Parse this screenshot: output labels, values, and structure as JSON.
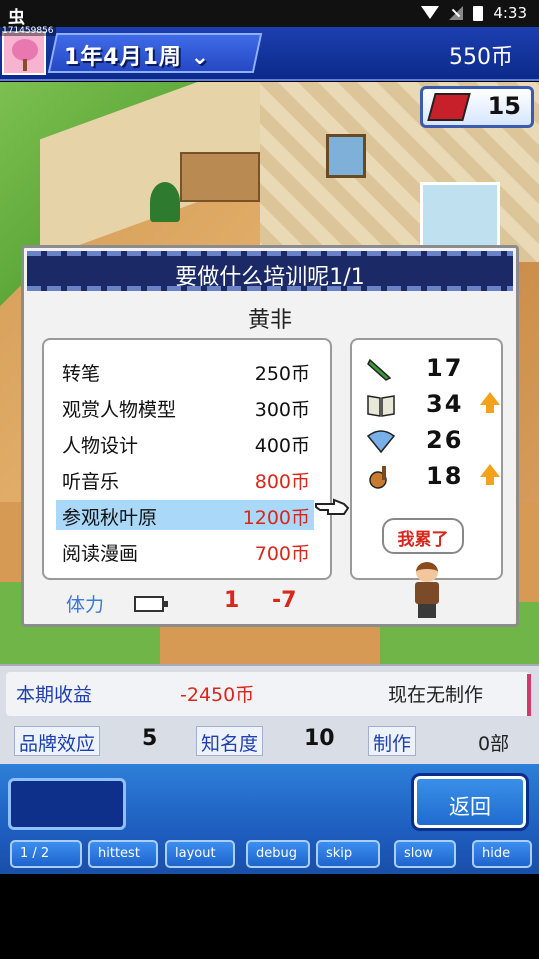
{
  "status_bar": {
    "time": "4:33",
    "left_icon": "虫",
    "icons": [
      "wifi-icon",
      "signal-icon",
      "battery-icon"
    ]
  },
  "header": {
    "user_id": "171459856",
    "date": "1年4月1周",
    "date_dropdown": "⌄",
    "money": "550币"
  },
  "tickets": {
    "count": "15"
  },
  "dialog": {
    "title": "要做什么培训呢1/1",
    "character_name": "黄非",
    "options": [
      {
        "name": "转笔",
        "cost": "250币",
        "affordable": true,
        "selected": false
      },
      {
        "name": "观赏人物模型",
        "cost": "300币",
        "affordable": true,
        "selected": false
      },
      {
        "name": "人物设计",
        "cost": "400币",
        "affordable": true,
        "selected": false
      },
      {
        "name": "听音乐",
        "cost": "800币",
        "affordable": false,
        "selected": false
      },
      {
        "name": "参观秋叶原",
        "cost": "1200币",
        "affordable": false,
        "selected": true
      },
      {
        "name": "阅读漫画",
        "cost": "700币",
        "affordable": false,
        "selected": false
      }
    ],
    "stats": [
      {
        "icon": "pencil-icon",
        "value": "17",
        "up": false
      },
      {
        "icon": "book-icon",
        "value": "34",
        "up": true
      },
      {
        "icon": "fan-icon",
        "value": "26",
        "up": false
      },
      {
        "icon": "guitar-icon",
        "value": "18",
        "up": true
      }
    ],
    "speech_bubble": "我累了",
    "stamina": {
      "label": "体力",
      "value": "1",
      "delta": "-7"
    }
  },
  "info_panel": {
    "income_label": "本期收益",
    "income_value": "-2450币",
    "production_status": "现在无制作",
    "brand_label": "品牌效应",
    "brand_value": "5",
    "fame_label": "知名度",
    "fame_value": "10",
    "production_label": "制作",
    "production_count": "0部"
  },
  "footer": {
    "back_label": "返回",
    "debug_buttons": [
      "1 / 2",
      "hittest",
      "layout",
      "debug",
      "skip",
      "slow",
      "hide"
    ]
  },
  "colors": {
    "header_blue": "#0b2a8a",
    "unaffordable_red": "#d8281c",
    "selected_highlight": "#a9d8f8",
    "label_blue": "#1f3fb0"
  }
}
